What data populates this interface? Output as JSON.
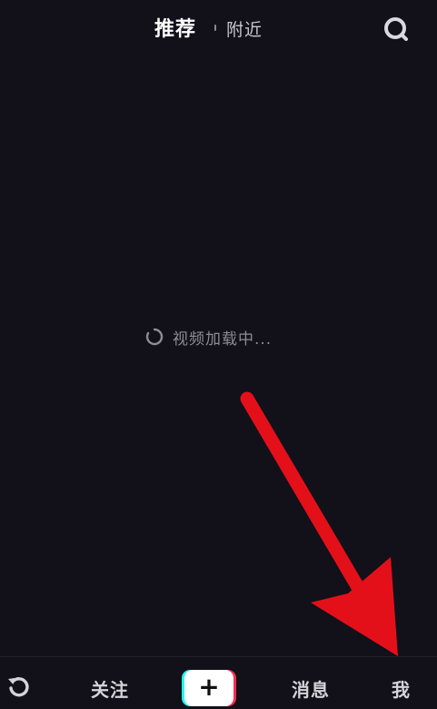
{
  "top_bar": {
    "tab_recommend": "推荐",
    "tab_nearby": "附近",
    "search_icon": "search-icon"
  },
  "content": {
    "loading_text": "视频加载中..."
  },
  "bottom_nav": {
    "refresh_icon": "refresh-icon",
    "follow_label": "关注",
    "create_label": "+",
    "messages_label": "消息",
    "me_label": "我"
  },
  "colors": {
    "background": "#121019",
    "arrow": "#e3101a",
    "brand_cyan": "#25f4ee",
    "brand_red": "#fe2c55"
  }
}
